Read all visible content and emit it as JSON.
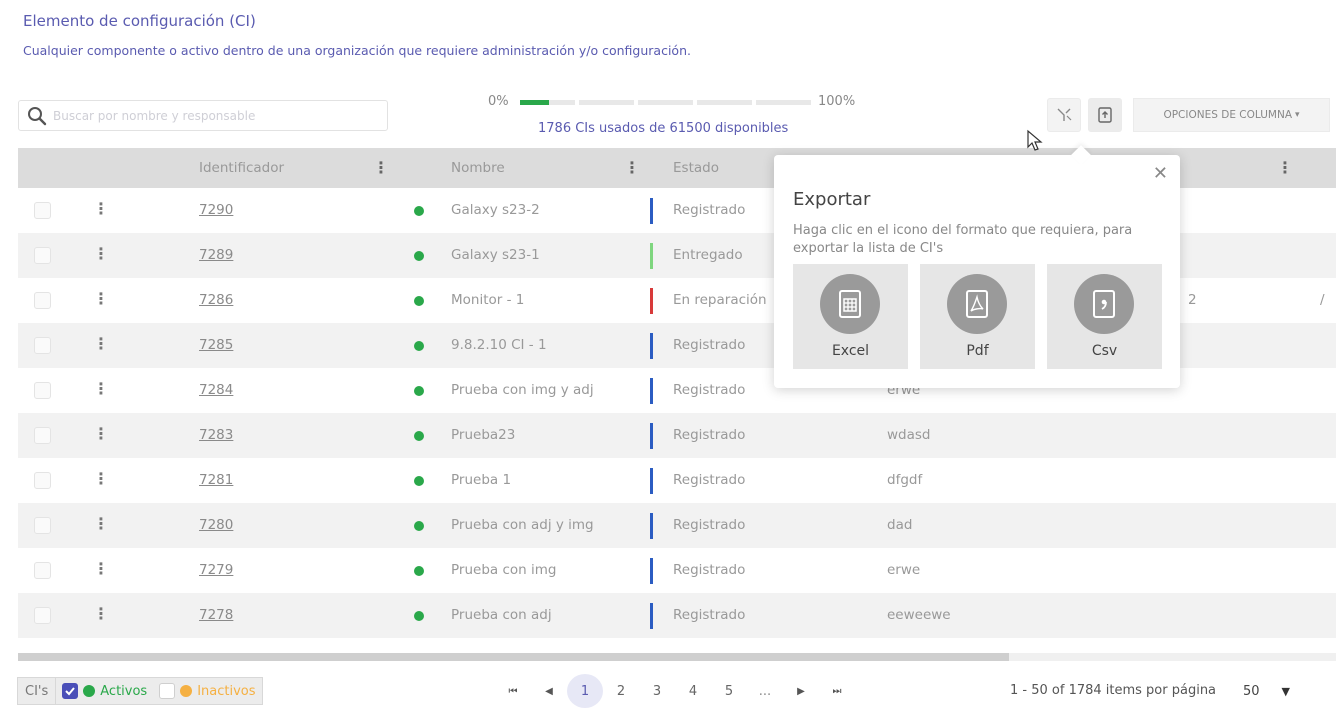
{
  "header": {
    "title": "Elemento de configuración (CI)",
    "description": "Cualquier componente o activo dentro de una organización que requiere administración y/o configuración."
  },
  "search": {
    "placeholder": "Buscar por nombre y responsable"
  },
  "usage": {
    "min_label": "0%",
    "max_label": "100%",
    "text": "1786 CIs usados de 61500 disponibles",
    "used": 1786,
    "total": 61500,
    "fill_fraction": 0.1
  },
  "toolbar": {
    "column_options": "OPCIONES DE COLUMNA"
  },
  "table": {
    "columns": [
      "Identificador",
      "Nombre",
      "Estado"
    ],
    "rows": [
      {
        "id": "7290",
        "name": "Galaxy s23-2",
        "status": "Registrado",
        "status_color": "#2b5cc2",
        "col5": "",
        "extra": "",
        "extra2": ""
      },
      {
        "id": "7289",
        "name": "Galaxy s23-1",
        "status": "Entregado",
        "status_color": "#7fd67f",
        "col5": "",
        "extra": "",
        "extra2": ""
      },
      {
        "id": "7286",
        "name": "Monitor - 1",
        "status": "En reparación",
        "status_color": "#d83a3a",
        "col5": "",
        "extra": "2",
        "extra2": "/"
      },
      {
        "id": "7285",
        "name": "9.8.2.10 CI - 1",
        "status": "Registrado",
        "status_color": "#2b5cc2",
        "col5": "",
        "extra": "",
        "extra2": ""
      },
      {
        "id": "7284",
        "name": "Prueba con img y adj",
        "status": "Registrado",
        "status_color": "#2b5cc2",
        "col5": "erwe",
        "extra": "",
        "extra2": ""
      },
      {
        "id": "7283",
        "name": "Prueba23",
        "status": "Registrado",
        "status_color": "#2b5cc2",
        "col5": "wdasd",
        "extra": "",
        "extra2": ""
      },
      {
        "id": "7281",
        "name": "Prueba 1",
        "status": "Registrado",
        "status_color": "#2b5cc2",
        "col5": "dfgdf",
        "extra": "",
        "extra2": ""
      },
      {
        "id": "7280",
        "name": "Prueba con adj y img",
        "status": "Registrado",
        "status_color": "#2b5cc2",
        "col5": "dad",
        "extra": "",
        "extra2": ""
      },
      {
        "id": "7279",
        "name": "Prueba con img",
        "status": "Registrado",
        "status_color": "#2b5cc2",
        "col5": "erwe",
        "extra": "",
        "extra2": ""
      },
      {
        "id": "7278",
        "name": "Prueba con adj",
        "status": "Registrado",
        "status_color": "#2b5cc2",
        "col5": "eeweewe",
        "extra": "",
        "extra2": ""
      }
    ]
  },
  "export_popover": {
    "title": "Exportar",
    "description": "Haga clic en el icono del formato que requiera, para exportar la lista de CI's",
    "formats": [
      {
        "label": "Excel",
        "icon": "spreadsheet-icon"
      },
      {
        "label": "Pdf",
        "icon": "pdf-icon"
      },
      {
        "label": "Csv",
        "icon": "csv-icon"
      }
    ]
  },
  "legend": {
    "label": "CI's",
    "activos": "Activos",
    "inactivos": "Inactivos",
    "activos_color": "#2aa84a",
    "inactivos_color": "#f5b042"
  },
  "pagination": {
    "pages": [
      "1",
      "2",
      "3",
      "4",
      "5"
    ],
    "current": "1",
    "ellipsis": "...",
    "info": "1 - 50 of 1784 items por página",
    "page_size": "50"
  },
  "colors": {
    "accent": "#5a5bb0",
    "active_green": "#2aa84a"
  }
}
